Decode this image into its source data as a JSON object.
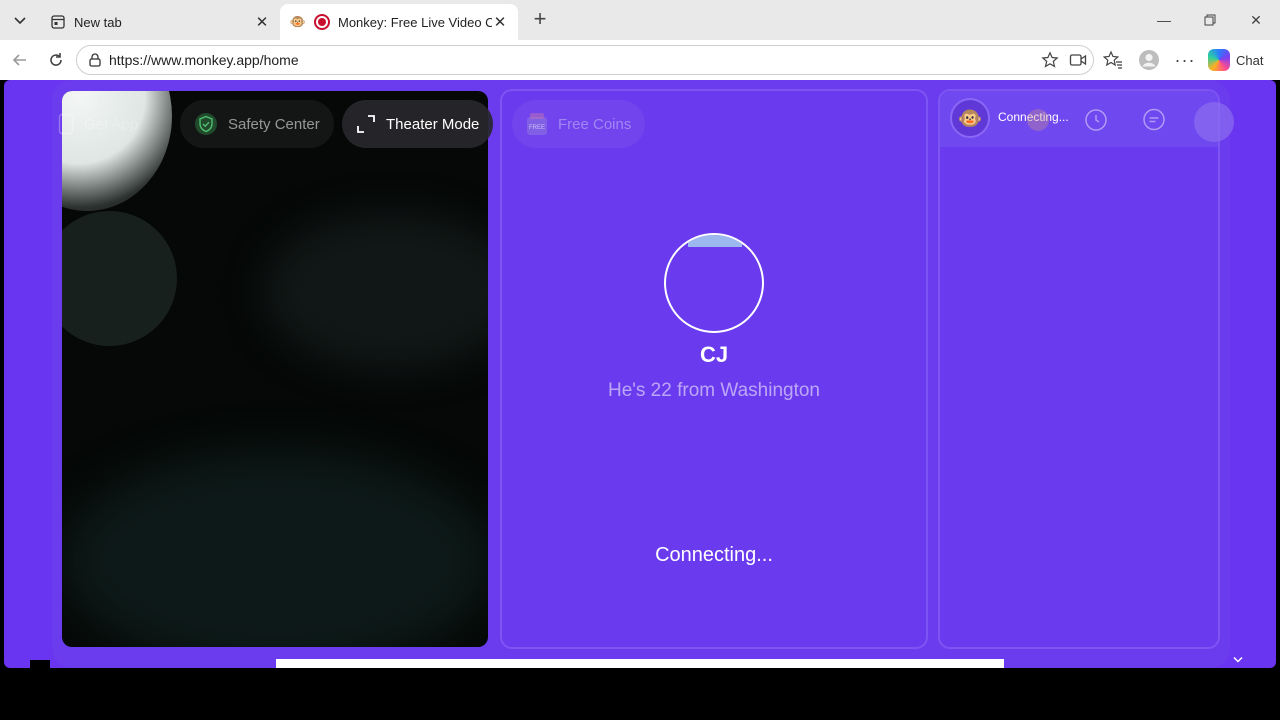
{
  "browser": {
    "tabs": [
      {
        "title": "New tab",
        "active": false
      },
      {
        "title": "Monkey: Free Live Video Chat",
        "active": true
      }
    ],
    "url": "https://www.monkey.app/home",
    "chat_label": "Chat"
  },
  "top_nav": {
    "get_app": "Get App",
    "safety_center": "Safety Center",
    "theater_mode": "Theater Mode",
    "free_coins": "Free Coins",
    "free_badge": "FREE"
  },
  "peer": {
    "name": "CJ",
    "subtitle": "He's 22 from Washington"
  },
  "status": {
    "center": "Connecting...",
    "side": "Connecting..."
  },
  "colors": {
    "page_purple": "#6a35f0",
    "panel_border": "#7c55f3",
    "recording_red": "#c8102e"
  }
}
